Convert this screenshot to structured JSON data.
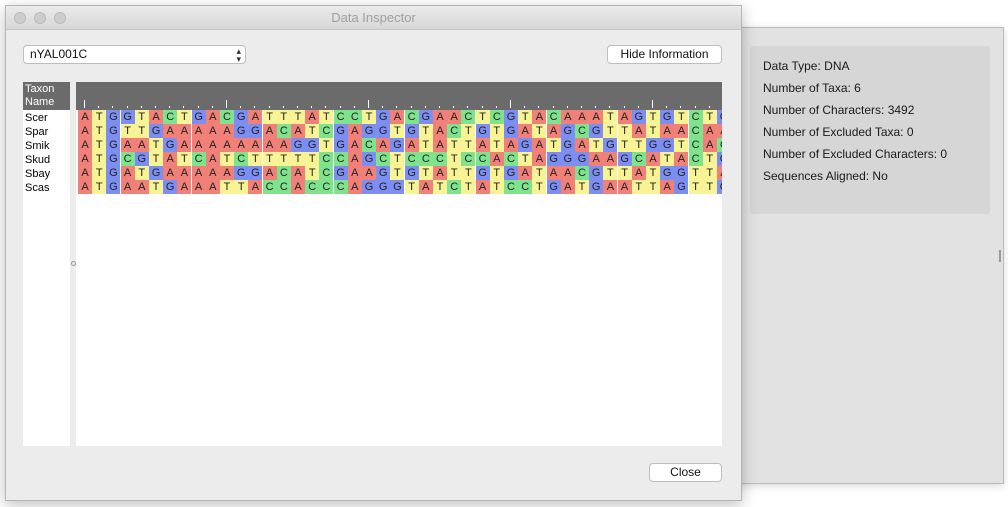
{
  "window": {
    "title": "Data Inspector"
  },
  "toolbar": {
    "dataset_selected": "nYAL001C",
    "hide_info_label": "Hide Information"
  },
  "taxon_column": {
    "header": "Taxon Name",
    "names": [
      "Scer",
      "Spar",
      "Smik",
      "Skud",
      "Sbay",
      "Scas"
    ]
  },
  "sequences": [
    "ATGGTACTGACGATTTATCCTGACGAACTCGTACAAATAGTGTCTG",
    "ATGTTGAAAAAGGACATCGAGGTGTACTGTGATAGCGTTATAACAA",
    "ATGAATGAAAAAAAAGGTGACAGATATTATAGATGATGTTGGTCACT",
    "ATGCGTATCATCTTTTTCCAGCTCCCTCCACTAGGGAAGCATACTG",
    "ATGATGAAAAAGGACATCGAAGTGTATTGTGATAACGTTATGGTTA",
    "ATGAATGAAATTACCACCCAGGGTATCTATCCTGATGAATTAGTTG"
  ],
  "base_colors": {
    "A": "#f08078",
    "T": "#f8f495",
    "G": "#7c8ef2",
    "C": "#7fe38d"
  },
  "button_close_label": "Close",
  "info_panel": {
    "lines": [
      "Data Type: DNA",
      "Number of Taxa: 6",
      "Number of Characters: 3492",
      "Number of Excluded Taxa: 0",
      "Number of Excluded Characters: 0",
      "Sequences Aligned: No"
    ]
  }
}
